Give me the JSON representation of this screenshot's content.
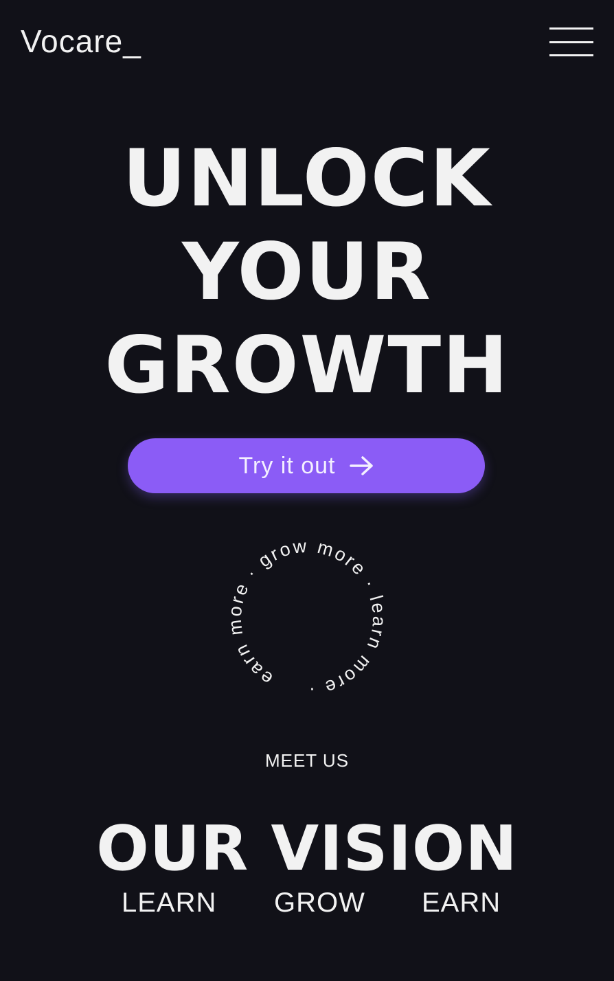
{
  "header": {
    "logo": "Vocare_",
    "menu_icon": "hamburger-menu-icon"
  },
  "hero": {
    "title_lines": [
      "UNLOCK",
      "YOUR",
      "GROWTH"
    ],
    "cta_label": "Try it out",
    "cta_icon": "arrow-right-icon",
    "cta_color": "#8b5cf6"
  },
  "badge": {
    "text": "earn more · grow more · learn more · "
  },
  "vision": {
    "eyebrow": "MEET US",
    "title": "OUR VISION",
    "pillars": [
      "LEARN",
      "GROW",
      "EARN"
    ]
  },
  "colors": {
    "background": "#111118",
    "text": "#f2f2f2",
    "accent": "#8b5cf6"
  }
}
